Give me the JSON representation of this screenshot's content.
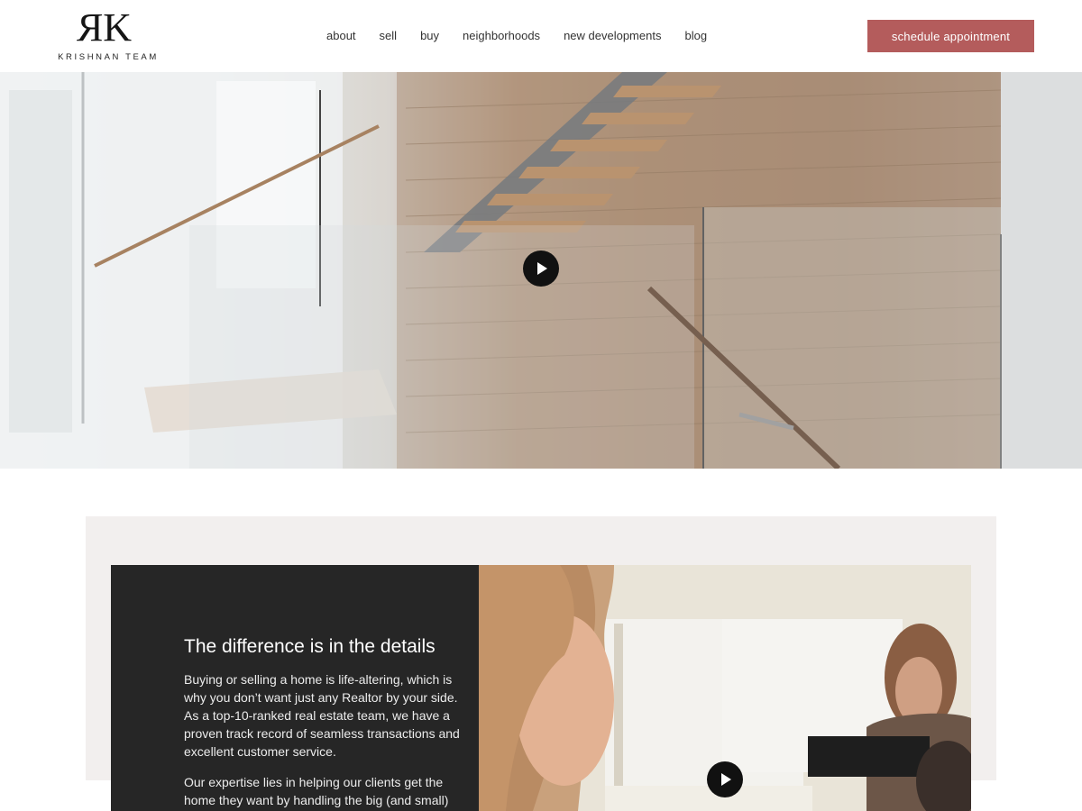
{
  "brand": {
    "logo_mark": "RK",
    "logo_text": "KRISHNAN TEAM"
  },
  "nav": {
    "items": [
      "about",
      "sell",
      "buy",
      "neighborhoods",
      "new developments",
      "blog"
    ]
  },
  "header": {
    "cta_label": "schedule appointment"
  },
  "hero": {
    "play_icon": "play-icon"
  },
  "feature": {
    "title": "The difference is in the details",
    "paragraph_1": "Buying or selling a home is life-altering, which is why you don’t want just any Realtor by your side. As a top-10-ranked real estate team, we have a proven track record of seamless transactions and excellent customer service.",
    "paragraph_2": "Our expertise lies in helping our clients get the home they want by handling the big (and small)",
    "play_icon": "play-icon"
  },
  "colors": {
    "accent": "#b45c5c",
    "dark_panel": "#262626",
    "section_bg": "#f2efee"
  }
}
